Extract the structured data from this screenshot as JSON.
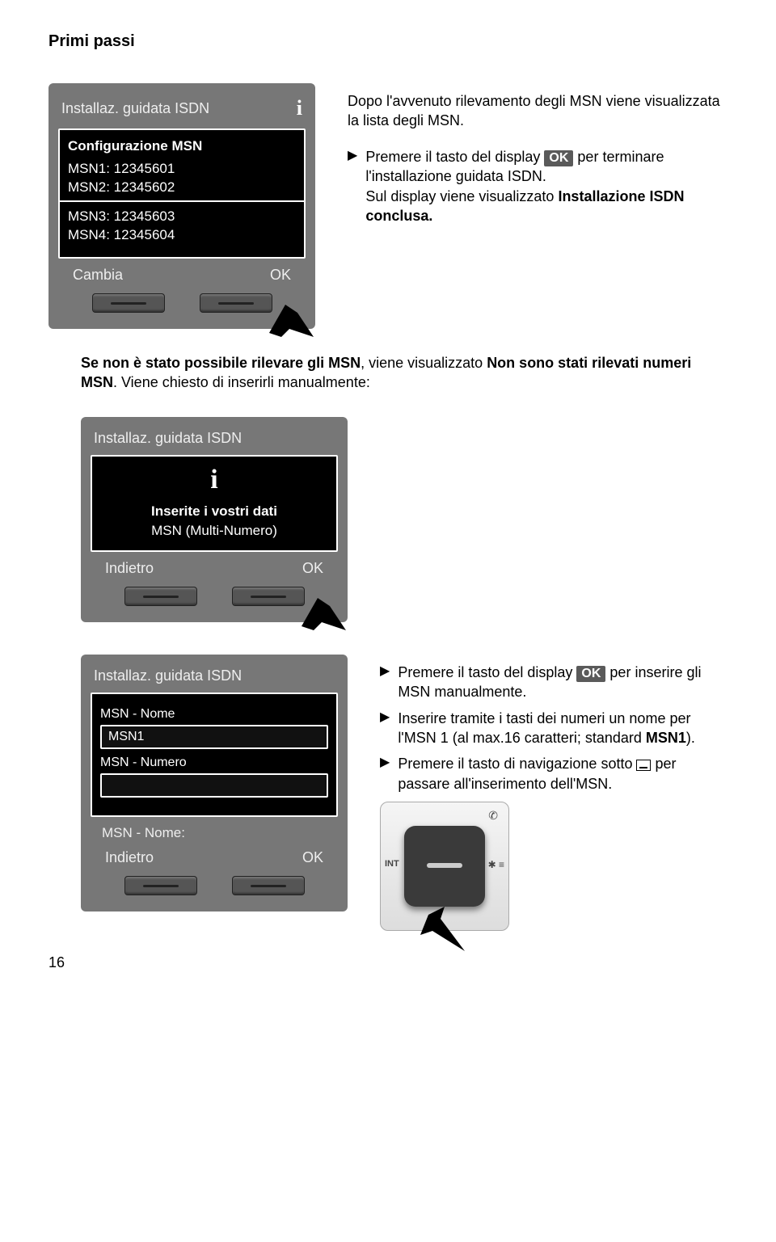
{
  "page": {
    "header": "Primi passi",
    "number": "16"
  },
  "screen1": {
    "title": "Installaz. guidata ISDN",
    "info_icon": "i",
    "heading": "Configurazione MSN",
    "lines": [
      "MSN1: 12345601",
      "MSN2: 12345602",
      "MSN3: 12345603",
      "MSN4: 12345604"
    ],
    "soft_left": "Cambia",
    "soft_right": "OK"
  },
  "para1": "Dopo l'avvenuto rilevamento degli MSN viene visualizzata la lista degli MSN.",
  "bullet1": {
    "pre": "Premere il tasto del display ",
    "ok": "OK",
    "mid": " per terminare l'installazione guidata ISDN.",
    "line2a": "Sul display viene visualizzato ",
    "line2b": "Installazione ISDN  conclusa."
  },
  "note1": {
    "a": "Se non è stato possibile rilevare gli MSN",
    "b": ", viene visualizzato ",
    "c": "Non sono stati rilevati numeri MSN",
    "d": ". Viene chiesto di inserirli manualmente:"
  },
  "screen2": {
    "title": "Installaz. guidata ISDN",
    "info_icon": "i",
    "msg": "Inserite i vostri dati",
    "sub": "MSN (Multi-Numero)",
    "soft_left": "Indietro",
    "soft_right": "OK"
  },
  "screen3": {
    "title": "Installaz. guidata ISDN",
    "label_name": "MSN - Nome",
    "value_name": "MSN1",
    "label_num": "MSN - Numero",
    "field_prompt": "MSN - Nome:",
    "soft_left": "Indietro",
    "soft_right": "OK"
  },
  "bullet2": {
    "pre": "Premere il tasto del display ",
    "ok": "OK",
    "post": " per inserire gli MSN manualmente."
  },
  "bullet3": {
    "a": "Inserire tramite i tasti dei numeri un nome per l'MSN 1 (al max.16 caratteri; standard ",
    "b": "MSN1",
    "c": ")."
  },
  "bullet4": {
    "a": "Premere il tasto di navigazione sotto ",
    "b": " per passare all'inserimento dell'MSN."
  },
  "nav": {
    "int": "INT"
  }
}
